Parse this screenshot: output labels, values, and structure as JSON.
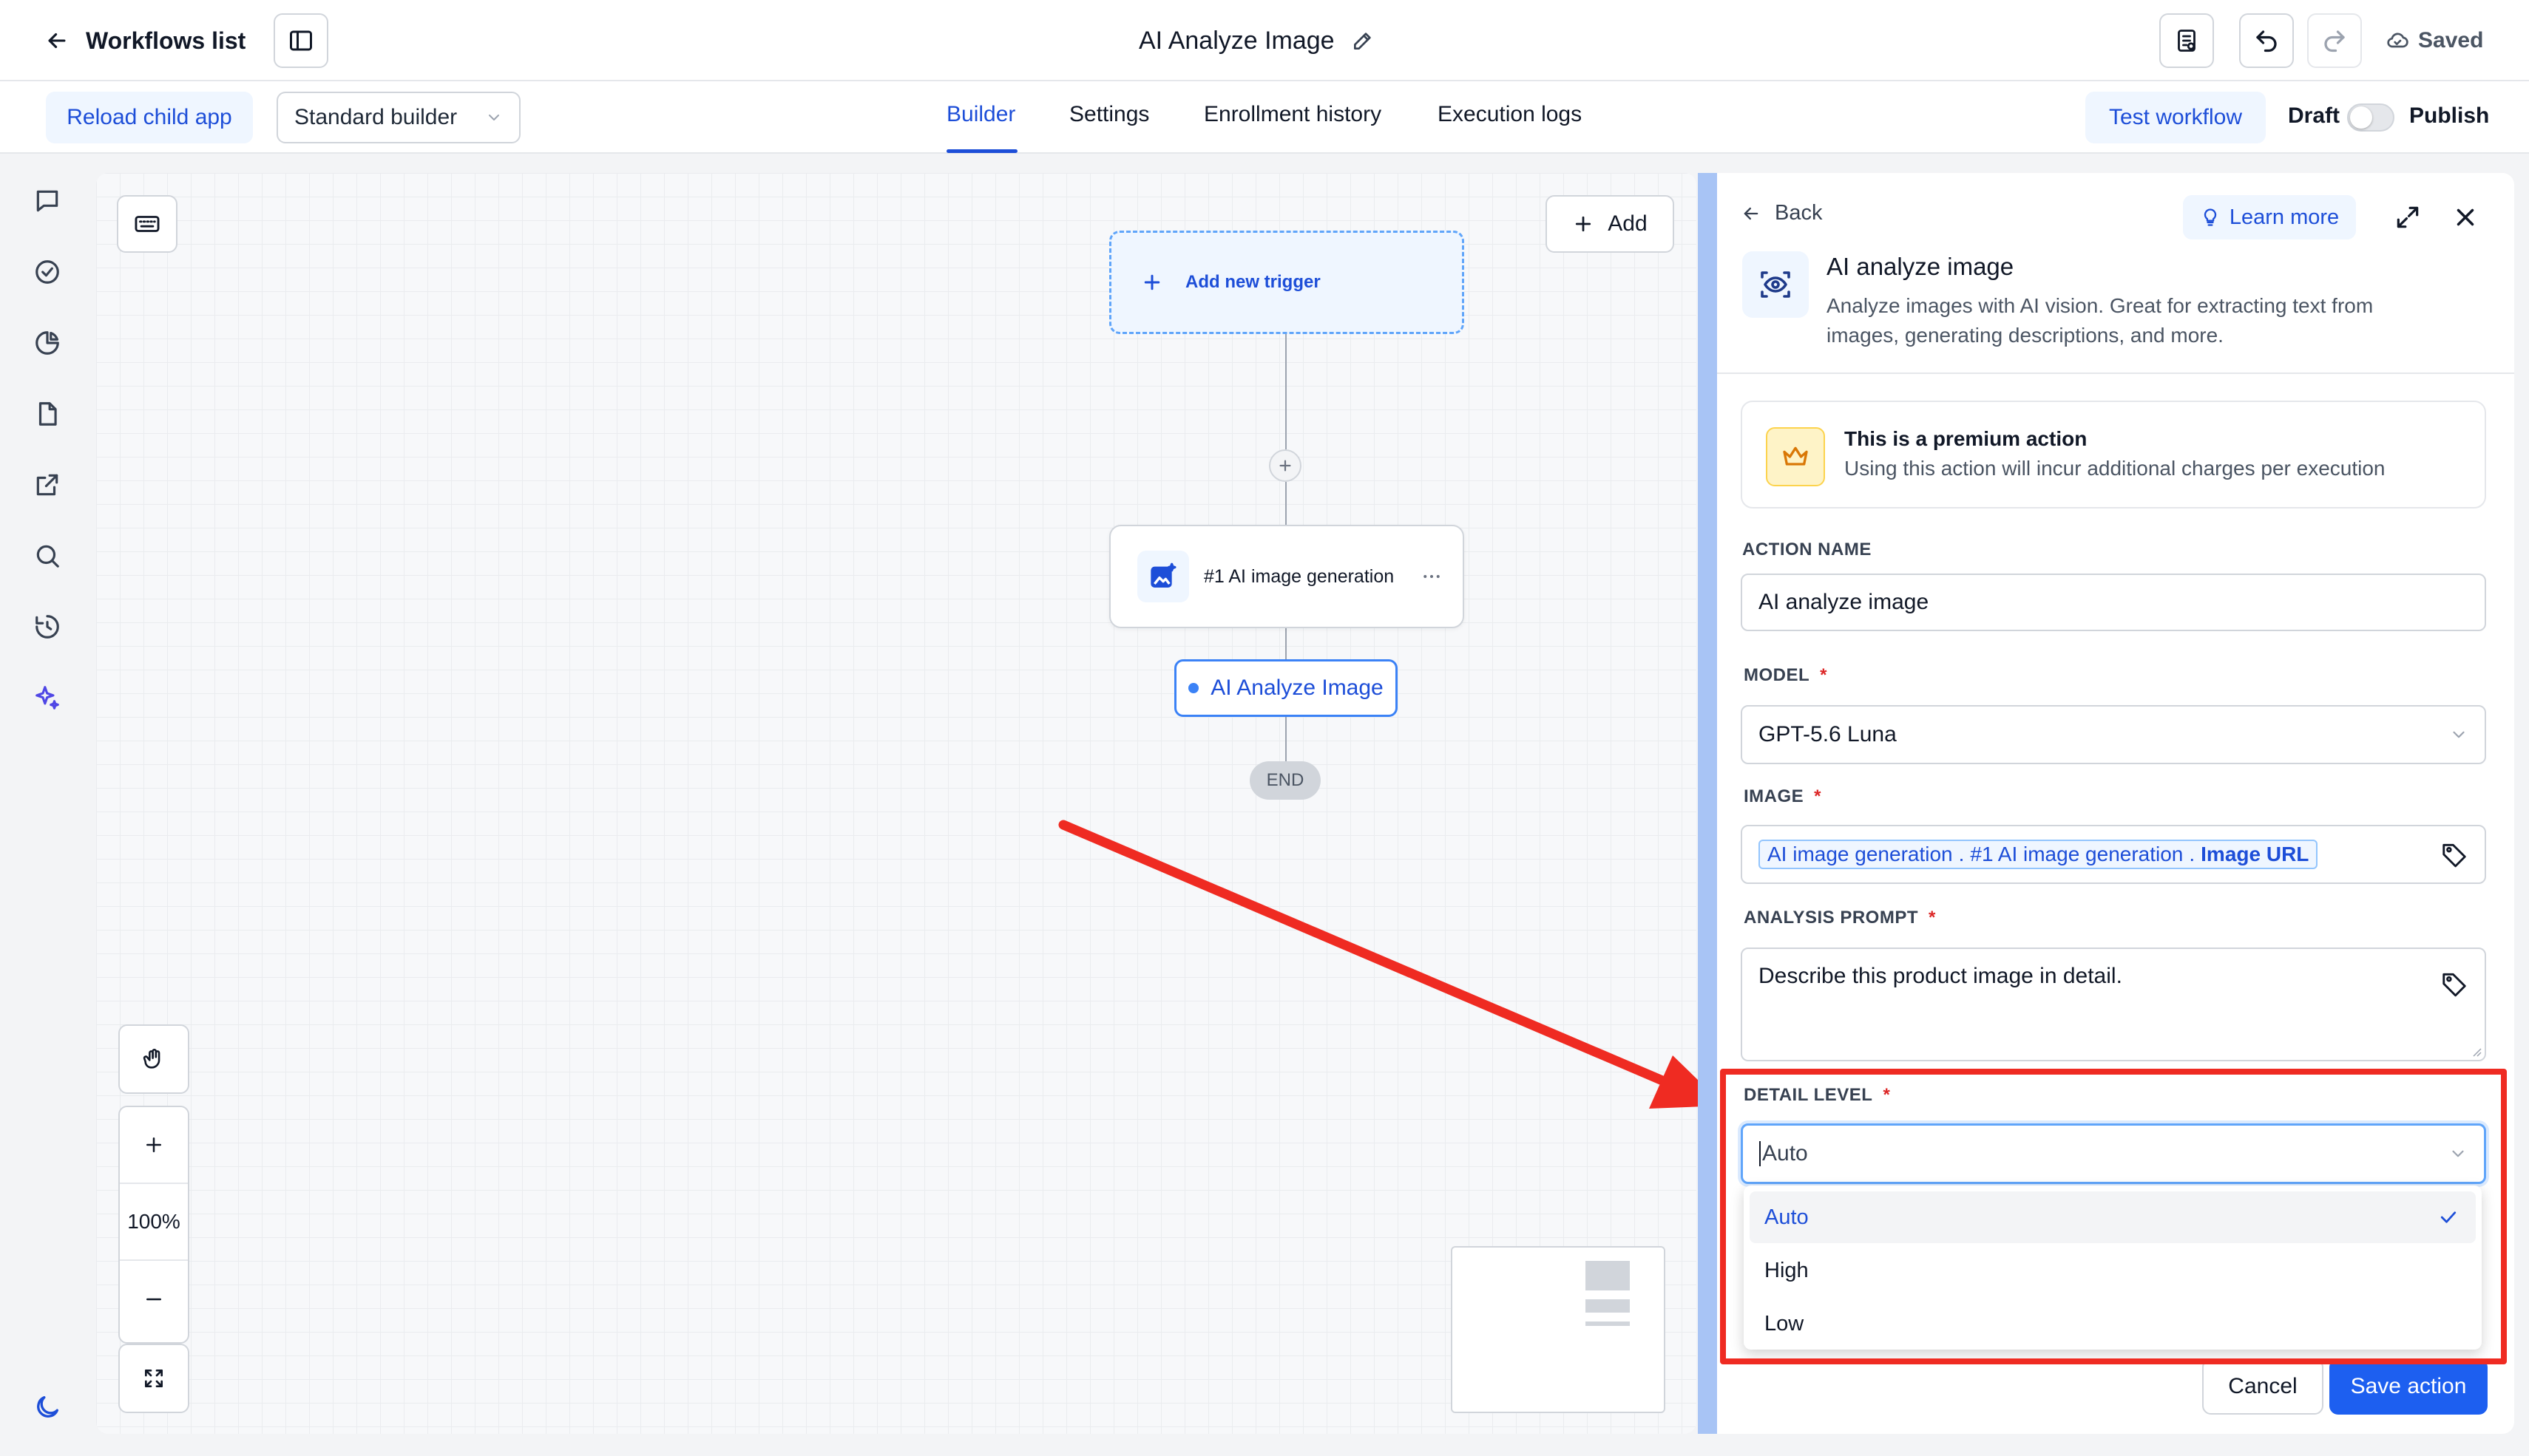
{
  "topbar": {
    "back_label": "Workflows list",
    "title": "AI Analyze Image",
    "saved_label": "Saved"
  },
  "secondbar": {
    "reload_label": "Reload child app",
    "builder_select": "Standard builder",
    "tabs": [
      "Builder",
      "Settings",
      "Enrollment history",
      "Execution logs"
    ],
    "active_tab": "Builder",
    "test_label": "Test workflow",
    "draft_label": "Draft",
    "publish_label": "Publish",
    "publish_toggle_on": false
  },
  "rail": {
    "icons": [
      "chat-icon",
      "check-circle-icon",
      "pie-chart-icon",
      "file-icon",
      "external-link-icon",
      "search-icon",
      "history-icon",
      "sparkles-icon",
      "moon-icon"
    ]
  },
  "canvas": {
    "add_label": "Add",
    "trigger_label": "Add new trigger",
    "step_label": "#1 AI image generation",
    "node_label": "AI Analyze Image",
    "end_label": "END",
    "zoom": "100%"
  },
  "panel": {
    "back_label": "Back",
    "learn_more_label": "Learn more",
    "title": "AI analyze image",
    "description_line1": "Analyze images with AI vision. Great for extracting text from",
    "description_line2": "images, generating descriptions, and more.",
    "premium_title": "This is a premium action",
    "premium_text": "Using this action will incur additional charges per execution",
    "action_name_label": "ACTION NAME",
    "action_name_value": "AI analyze image",
    "model_label": "MODEL",
    "model_value": "GPT-5.6 Luna",
    "image_label": "IMAGE",
    "image_token": {
      "part1": "AI image generation",
      "part2": "#1 AI image generation",
      "part3": "Image URL",
      "separator": "."
    },
    "prompt_label": "ANALYSIS PROMPT",
    "prompt_value": "Describe this product image in detail.",
    "detail_label": "DETAIL LEVEL",
    "detail_value": "Auto",
    "detail_options": [
      "Auto",
      "High",
      "Low"
    ],
    "detail_selected": "Auto",
    "cancel_label": "Cancel",
    "save_label": "Save action"
  },
  "colors": {
    "accent": "#1d4ed8",
    "primary_button": "#1d5ff0",
    "annotation_red": "#ef2b22",
    "premium_bg": "#fef3c7"
  }
}
